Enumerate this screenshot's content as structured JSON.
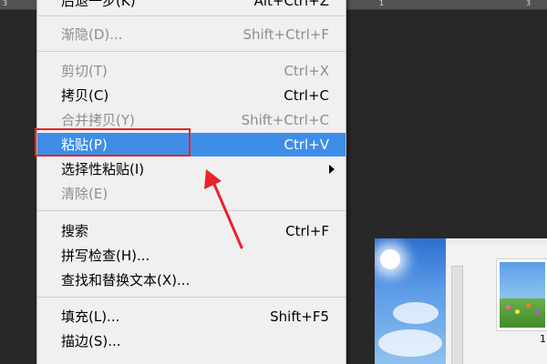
{
  "ruler": {
    "numbers": [
      "3",
      "1",
      "3"
    ]
  },
  "menu": {
    "items": [
      {
        "label": "后退一步(K)",
        "shortcut": "Alt+Ctrl+Z",
        "disabled": false
      },
      {
        "label": "渐隐(D)...",
        "shortcut": "Shift+Ctrl+F",
        "disabled": true
      },
      {
        "label": "剪切(T)",
        "shortcut": "Ctrl+X",
        "disabled": true
      },
      {
        "label": "拷贝(C)",
        "shortcut": "Ctrl+C",
        "disabled": false
      },
      {
        "label": "合并拷贝(Y)",
        "shortcut": "Shift+Ctrl+C",
        "disabled": true
      },
      {
        "label": "粘贴(P)",
        "shortcut": "Ctrl+V",
        "disabled": false,
        "highlighted": true
      },
      {
        "label": "选择性粘贴(I)",
        "shortcut": "",
        "disabled": false,
        "submenu": true
      },
      {
        "label": "清除(E)",
        "shortcut": "",
        "disabled": true
      },
      {
        "label": "搜索",
        "shortcut": "Ctrl+F",
        "disabled": false
      },
      {
        "label": "拼写检查(H)...",
        "shortcut": "",
        "disabled": false
      },
      {
        "label": "查找和替换文本(X)...",
        "shortcut": "",
        "disabled": false
      },
      {
        "label": "填充(L)...",
        "shortcut": "Shift+F5",
        "disabled": false
      },
      {
        "label": "描边(S)...",
        "shortcut": "",
        "disabled": false
      }
    ]
  },
  "annotation": {
    "color": "#e8232a"
  },
  "colors": {
    "highlight": "#3e8ee8",
    "menu_bg": "#f0f0f0",
    "workspace": "#282828"
  },
  "document_preview": {
    "caption": "1"
  }
}
